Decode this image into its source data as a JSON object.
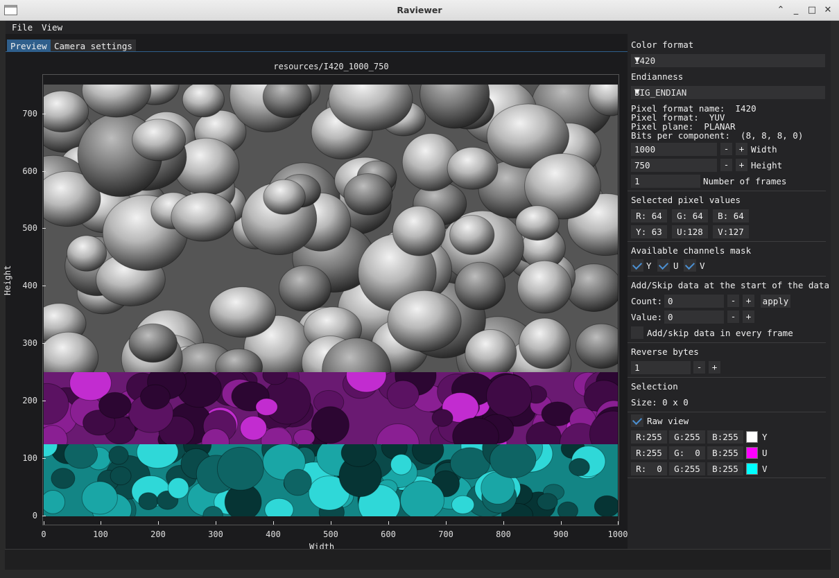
{
  "window": {
    "title": "Raviewer"
  },
  "menu": {
    "file": "File",
    "view": "View"
  },
  "tabs": {
    "preview": "Preview",
    "camera": "Camera settings"
  },
  "plot": {
    "title": "resources/I420_1000_750",
    "xlabel": "Width",
    "ylabel": "Height",
    "xticks": [
      "0",
      "100",
      "200",
      "300",
      "400",
      "500",
      "600",
      "700",
      "800",
      "900",
      "1000"
    ],
    "yticks": [
      "700",
      "600",
      "500",
      "400",
      "300",
      "200",
      "100",
      "0"
    ]
  },
  "settings": {
    "color_format_label": "Color format",
    "color_format_value": "I420",
    "endianness_label": "Endianness",
    "endianness_value": "BIG_ENDIAN",
    "pixel_format_name": "Pixel format name:  I420",
    "pixel_format": "Pixel format:  YUV",
    "pixel_plane": "Pixel plane:  PLANAR",
    "bits_per_component": "Bits per component:  (8, 8, 8, 0)",
    "width_value": "1000",
    "width_label": "Width",
    "height_value": "750",
    "height_label": "Height",
    "frames_value": "1",
    "frames_label": "Number of frames",
    "minus": "-",
    "plus": "+"
  },
  "selected_pixel": {
    "label": "Selected pixel values",
    "r": "R: 64",
    "g": "G: 64",
    "b": "B: 64",
    "y": "Y: 63",
    "u": "U:128",
    "v": "V:127"
  },
  "channels": {
    "label": "Available channels mask",
    "y": "Y",
    "u": "U",
    "v": "V"
  },
  "add_skip": {
    "label": "Add/Skip data at the start of the data",
    "count_label": "Count:",
    "count_value": "0",
    "apply": "apply",
    "value_label": "Value:",
    "value_value": "0",
    "every_frame": "Add/skip data in every frame"
  },
  "reverse": {
    "label": "Reverse bytes",
    "value": "1"
  },
  "selection": {
    "label": "Selection",
    "size": "Size: 0 x 0"
  },
  "raw_view": {
    "label": "Raw view",
    "rows": [
      {
        "r": "R:255",
        "g": "G:255",
        "b": "B:255",
        "channel": "Y",
        "color": "#ffffff"
      },
      {
        "r": "R:255",
        "g": "G:  0",
        "b": "B:255",
        "channel": "U",
        "color": "#ff00ff"
      },
      {
        "r": "R:  0",
        "g": "G:255",
        "b": "B:255",
        "channel": "V",
        "color": "#00ffff"
      }
    ]
  },
  "colors": {
    "accent": "#2f5f8c",
    "check": "#4b8fd1"
  }
}
